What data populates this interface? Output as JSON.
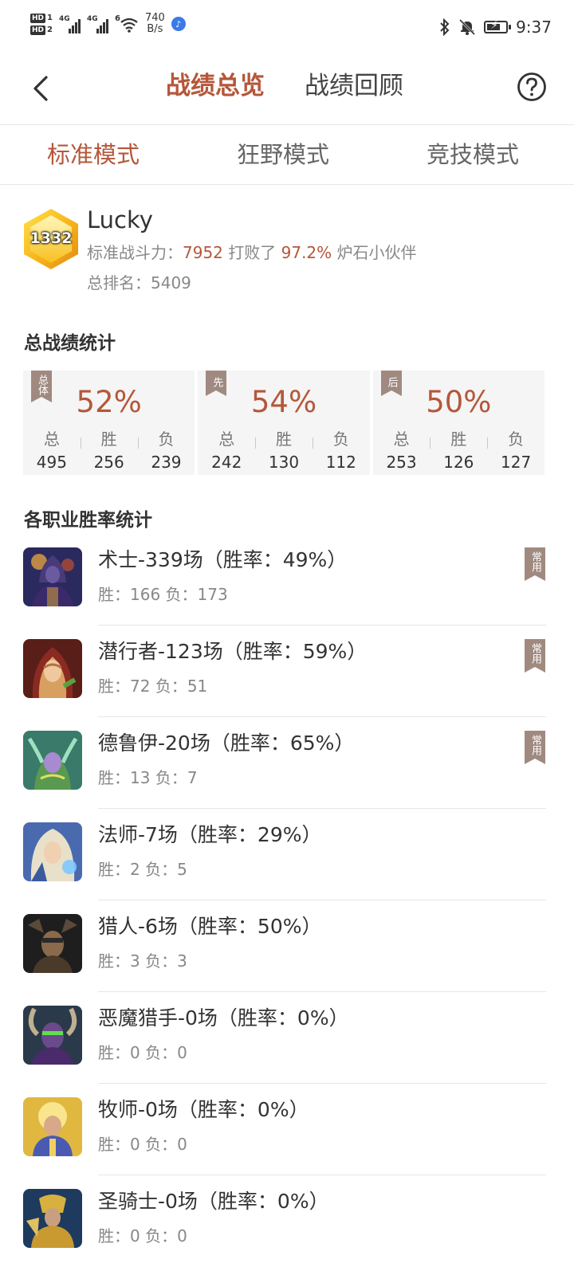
{
  "status_bar": {
    "hd1": "HD",
    "hd1_num": "1",
    "hd2": "HD",
    "hd2_num": "2",
    "sim1_tag": "4G",
    "sim2_tag": "4G",
    "wifi_tag": "6",
    "net_speed_value": "740",
    "net_speed_unit": "B/s",
    "time": "9:37"
  },
  "header": {
    "tab_overview": "战绩总览",
    "tab_review": "战绩回顾"
  },
  "mode_tabs": [
    {
      "label": "标准模式",
      "active": true
    },
    {
      "label": "狂野模式",
      "active": false
    },
    {
      "label": "竞技模式",
      "active": false
    }
  ],
  "profile": {
    "rank_number": "1332",
    "name": "Lucky",
    "power_label": "标准战斗力：",
    "power_value": "7952",
    "defeated_label": " 打败了 ",
    "defeated_pct": "97.2%",
    "defeated_suffix": " 炉石小伙伴",
    "total_rank_label": "总排名：",
    "total_rank_value": "5409"
  },
  "summary": {
    "title": "总战绩统计",
    "col_total": "总",
    "col_win": "胜",
    "col_loss": "负",
    "cards": [
      {
        "tag": "总体",
        "pct": "52%",
        "total": "495",
        "win": "256",
        "loss": "239"
      },
      {
        "tag": "先",
        "pct": "54%",
        "total": "242",
        "win": "130",
        "loss": "112"
      },
      {
        "tag": "后",
        "pct": "50%",
        "total": "253",
        "win": "126",
        "loss": "127"
      }
    ]
  },
  "classes": {
    "title": "各职业胜率统计",
    "common_tag": "常用",
    "win_label": "胜：",
    "loss_label": "负：",
    "items": [
      {
        "title": "术士-339场（胜率：49%）",
        "win": "166",
        "loss": "173",
        "common": true,
        "icon": "warlock-portrait",
        "color1": "#2a2a5e",
        "color2": "#c89a3a"
      },
      {
        "title": "潜行者-123场（胜率：59%）",
        "win": "72",
        "loss": "51",
        "common": true,
        "icon": "rogue-portrait",
        "color1": "#6a1e1a",
        "color2": "#d8a060"
      },
      {
        "title": "德鲁伊-20场（胜率：65%）",
        "win": "13",
        "loss": "7",
        "common": true,
        "icon": "druid-portrait",
        "color1": "#3a6a5a",
        "color2": "#a88ad0"
      },
      {
        "title": "法师-7场（胜率：29%）",
        "win": "2",
        "loss": "5",
        "common": false,
        "icon": "mage-portrait",
        "color1": "#4a6ab0",
        "color2": "#e0d8c0"
      },
      {
        "title": "猎人-6场（胜率：50%）",
        "win": "3",
        "loss": "3",
        "common": false,
        "icon": "hunter-portrait",
        "color1": "#2a2a2a",
        "color2": "#8a6a4a"
      },
      {
        "title": "恶魔猎手-0场（胜率：0%）",
        "win": "0",
        "loss": "0",
        "common": false,
        "icon": "demon-hunter-portrait",
        "color1": "#3a2a5a",
        "color2": "#5ab04a"
      },
      {
        "title": "牧师-0场（胜率：0%）",
        "win": "0",
        "loss": "0",
        "common": false,
        "icon": "priest-portrait",
        "color1": "#d8b040",
        "color2": "#4a5ab0"
      },
      {
        "title": "圣骑士-0场（胜率：0%）",
        "win": "0",
        "loss": "0",
        "common": false,
        "icon": "paladin-portrait",
        "color1": "#2a4a7a",
        "color2": "#d8b040"
      }
    ]
  },
  "colors": {
    "accent": "#b5573a",
    "tag_bg": "#a08a80"
  }
}
